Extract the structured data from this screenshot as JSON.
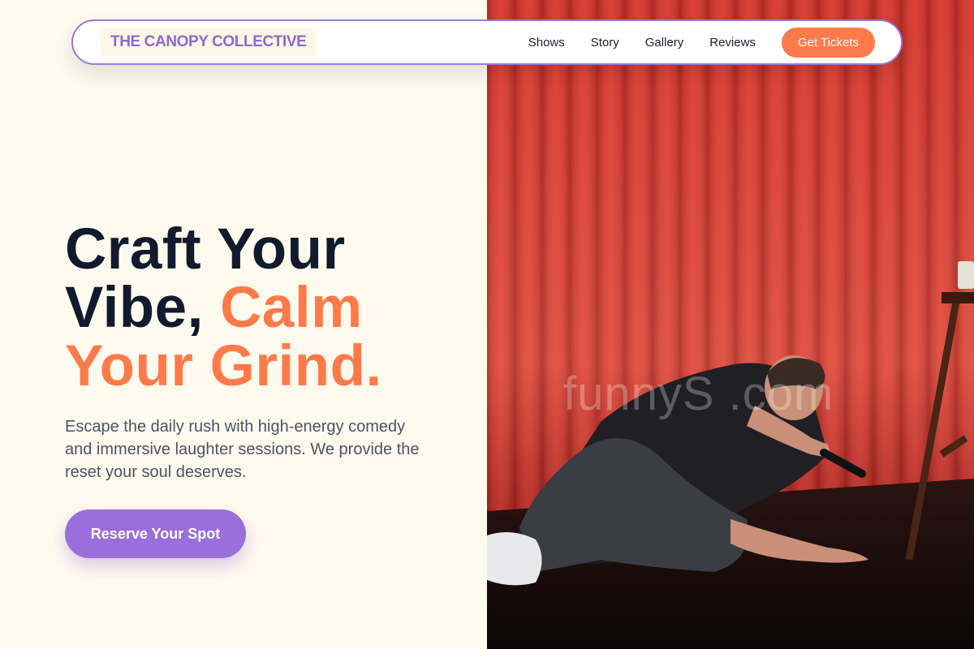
{
  "nav": {
    "brand": "THE CANOPY COLLECTIVE",
    "links": [
      {
        "label": "Shows"
      },
      {
        "label": "Story"
      },
      {
        "label": "Gallery"
      },
      {
        "label": "Reviews"
      }
    ],
    "cta_label": "Get Tickets"
  },
  "hero": {
    "headline_line1": "Craft Your",
    "headline_line2a": "Vibe, ",
    "headline_line2b": "Calm",
    "headline_line3": "Your Grind.",
    "description": "Escape the daily rush with high-energy comedy and immersive laughter sessions. We provide the reset your soul deserves.",
    "button_label": "Reserve Your Spot",
    "image_watermark": "funnyS      .com"
  },
  "colors": {
    "background": "#fffaee",
    "accent_orange": "#ff7a4a",
    "accent_purple": "#9a6fdb",
    "heading": "#111a2e",
    "curtain_red": "#d8342c"
  }
}
